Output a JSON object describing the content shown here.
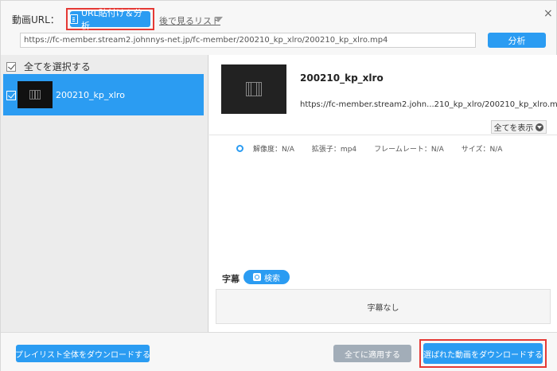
{
  "header": {
    "url_label": "動画URL：",
    "paste_analyze_label": "URL貼付け＆分析",
    "watch_later_label": "後で見るリスト",
    "close_glyph": "×"
  },
  "url_input": {
    "value": "https://fc-member.stream2.johnnys-net.jp/fc-member/200210_kp_xlro/200210_kp_xlro.mp4"
  },
  "analyze_label": "分析",
  "sidebar": {
    "select_all_label": "全てを選択する",
    "items": [
      {
        "title": "200210_kp_xlro",
        "checked": true
      }
    ]
  },
  "detail": {
    "title": "200210_kp_xlro",
    "url": "https://fc-member.stream2.john...210_kp_xlro/200210_kp_xlro.mp4",
    "show_all_label": "全てを表示",
    "format": {
      "resolution": "解像度：N/A",
      "extension": "拡張子：mp4",
      "framerate": "フレームレート：N/A",
      "size": "サイズ：N/A"
    },
    "subtitle_label": "字幕",
    "search_label": "検索",
    "no_subtitle_label": "字幕なし"
  },
  "footer": {
    "playlist_download_label": "プレイリスト全体をダウンロードする",
    "apply_all_label": "全てに適用する",
    "download_selected_label": "選ばれた動画をダウンロードする"
  },
  "colors": {
    "accent": "#2b9cf2",
    "highlight": "#e53935",
    "disabled": "#a2adb8"
  }
}
